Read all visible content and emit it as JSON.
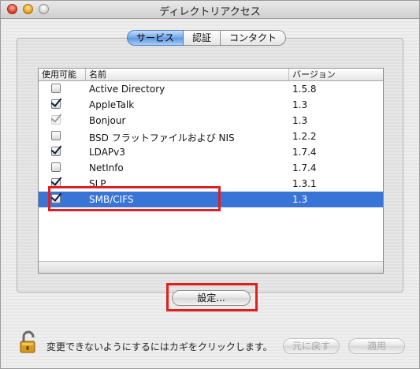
{
  "window": {
    "title": "ディレクトリアクセス"
  },
  "tabs": [
    {
      "label": "サービス",
      "active": true
    },
    {
      "label": "認証",
      "active": false
    },
    {
      "label": "コンタクト",
      "active": false
    }
  ],
  "table": {
    "columns": {
      "use": "使用可能",
      "name": "名前",
      "version": "バージョン"
    },
    "rows": [
      {
        "name": "Active Directory",
        "version": "1.5.8",
        "checked": false,
        "state": "unchecked"
      },
      {
        "name": "AppleTalk",
        "version": "1.3",
        "checked": true,
        "state": "checked"
      },
      {
        "name": "Bonjour",
        "version": "1.3",
        "checked": true,
        "state": "checked-disabled"
      },
      {
        "name": "BSD フラットファイルおよび NIS",
        "version": "1.2.2",
        "checked": false,
        "state": "unchecked"
      },
      {
        "name": "LDAPv3",
        "version": "1.7.4",
        "checked": true,
        "state": "checked"
      },
      {
        "name": "NetInfo",
        "version": "1.7.4",
        "checked": false,
        "state": "unchecked"
      },
      {
        "name": "SLP",
        "version": "1.3.1",
        "checked": true,
        "state": "checked"
      },
      {
        "name": "SMB/CIFS",
        "version": "1.3",
        "checked": true,
        "state": "checked-selected"
      }
    ],
    "selected_row": "SMB/CIFS"
  },
  "buttons": {
    "configure": "設定...",
    "revert": "元に戻す",
    "apply": "適用"
  },
  "footer": {
    "lock_text": "変更できないようにするにはカギをクリックします。"
  },
  "colors": {
    "selection": "#3875d7",
    "highlight": "#e01f1f",
    "tab_active": "#6fa5e8"
  },
  "icons": {
    "lock": "padlock-open-icon",
    "checkbox": "check-icon"
  }
}
